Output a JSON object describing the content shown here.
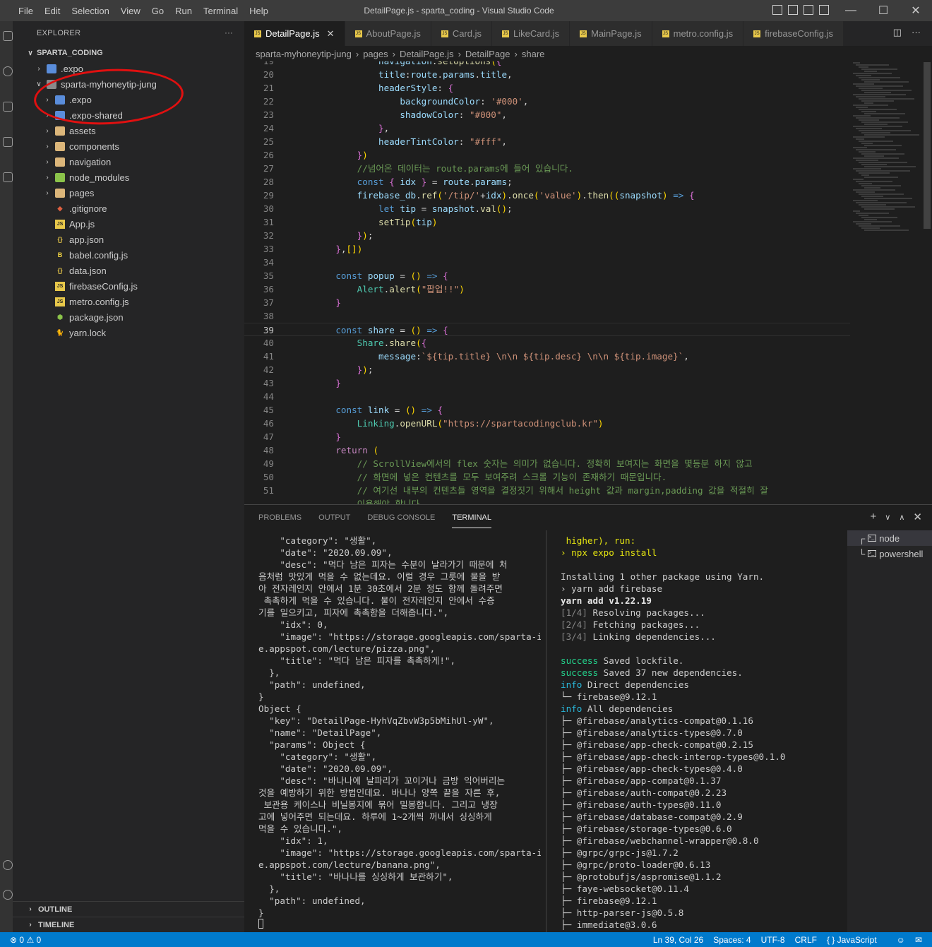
{
  "window": {
    "title": "DetailPage.js - sparta_coding - Visual Studio Code",
    "menu": [
      "File",
      "Edit",
      "Selection",
      "View",
      "Go",
      "Run",
      "Terminal",
      "Help"
    ]
  },
  "explorer": {
    "header": "EXPLORER",
    "more": "···",
    "root": "SPARTA_CODING",
    "items": [
      {
        "label": ".expo",
        "icon": "folder-expo-icon"
      },
      {
        "label": "sparta-myhoneytip-jung",
        "icon": "folder-open-icon"
      },
      {
        "label": ".expo",
        "icon": "folder-expo-icon"
      },
      {
        "label": ".expo-shared",
        "icon": "folder-expo-icon"
      },
      {
        "label": "assets",
        "icon": "folder-icon"
      },
      {
        "label": "components",
        "icon": "folder-icon"
      },
      {
        "label": "navigation",
        "icon": "folder-icon"
      },
      {
        "label": "node_modules",
        "icon": "folder-node-icon"
      },
      {
        "label": "pages",
        "icon": "folder-icon"
      },
      {
        "label": ".gitignore",
        "icon": "git-icon"
      },
      {
        "label": "App.js",
        "icon": "js-file-icon"
      },
      {
        "label": "app.json",
        "icon": "json-file-icon"
      },
      {
        "label": "babel.config.js",
        "icon": "babel-icon"
      },
      {
        "label": "data.json",
        "icon": "json-file-icon"
      },
      {
        "label": "firebaseConfig.js",
        "icon": "js-file-icon"
      },
      {
        "label": "metro.config.js",
        "icon": "js-file-icon"
      },
      {
        "label": "package.json",
        "icon": "nodejs-icon"
      },
      {
        "label": "yarn.lock",
        "icon": "yarn-icon"
      }
    ],
    "outline": "OUTLINE",
    "timeline": "TIMELINE"
  },
  "tabs": [
    {
      "label": "DetailPage.js",
      "active": true
    },
    {
      "label": "AboutPage.js"
    },
    {
      "label": "Card.js"
    },
    {
      "label": "LikeCard.js"
    },
    {
      "label": "MainPage.js"
    },
    {
      "label": "metro.config.js"
    },
    {
      "label": "firebaseConfig.js"
    }
  ],
  "breadcrumb": [
    "sparta-myhoneytip-jung",
    "pages",
    "DetailPage.js",
    "DetailPage",
    "share"
  ],
  "code": {
    "first_line": 19,
    "current_line": 39,
    "lines": [
      "            navigation.setOptions({",
      "            title:route.params.title,",
      "            headerStyle: {",
      "                backgroundColor: '#000',",
      "                shadowColor: \"#000\",",
      "            },",
      "            headerTintColor: \"#fff\",",
      "        })",
      "        //넘어온 데이터는 route.params에 들어 있습니다.",
      "        const { idx } = route.params;",
      "        firebase_db.ref('/tip/'+idx).once('value').then((snapshot) => {",
      "            let tip = snapshot.val();",
      "            setTip(tip)",
      "        });",
      "    },[])",
      "",
      "    const popup = () => {",
      "        Alert.alert(\"팝업!!\")",
      "    }",
      "",
      "    const share = () => {",
      "        Share.share({",
      "            message:`${tip.title} \\n\\n ${tip.desc} \\n\\n ${tip.image}`,",
      "        });",
      "    }",
      "",
      "    const link = () => {",
      "        Linking.openURL(\"https://spartacodingclub.kr\")",
      "    }",
      "    return (",
      "        // ScrollView에서의 flex 숫자는 의미가 없습니다. 정확히 보여지는 화면을 몇등분 하지 않고",
      "        // 화면에 넣은 컨텐츠를 모두 보여주려 스크롤 기능이 존재하기 때문입니다.",
      "        // 여기선 내부의 컨텐츠들 영역을 결정짓기 위해서 height 값과 margin,padding 값을 적절히 잘",
      "        이용해야 합니다."
    ]
  },
  "panel": {
    "tabs": [
      "PROBLEMS",
      "OUTPUT",
      "DEBUG CONSOLE",
      "TERMINAL"
    ],
    "active_tab": "TERMINAL",
    "terminal_left": [
      "    \"category\": \"생활\",",
      "    \"date\": \"2020.09.09\",",
      "    \"desc\": \"먹다 남은 피자는 수분이 날라가기 때문에 처",
      "음처럼 맛있게 먹을 수 없는데요. 이럴 경우 그릇에 물을 받",
      "아 전자레인지 안에서 1분 30초에서 2분 정도 함께 돌려주면",
      " 촉촉하게 먹을 수 있습니다. 물이 전자레인지 안에서 수증",
      "기를 일으키고, 피자에 촉촉함을 더해줍니다.\",",
      "    \"idx\": 0,",
      "    \"image\": \"https://storage.googleapis.com/sparta-imag",
      "e.appspot.com/lecture/pizza.png\",",
      "    \"title\": \"먹다 남은 피자를 촉촉하게!\",",
      "  },",
      "  \"path\": undefined,",
      "}",
      "Object {",
      "  \"key\": \"DetailPage-HyhVqZbvW3p5bMihUl-yW\",",
      "  \"name\": \"DetailPage\",",
      "  \"params\": Object {",
      "    \"category\": \"생활\",",
      "    \"date\": \"2020.09.09\",",
      "    \"desc\": \"바나나에 날파리가 꼬이거나 금방 익어버리는",
      "것을 예방하기 위한 방법인데요. 바나나 양쪽 끝을 자른 후,",
      " 보관용 케이스나 비닐봉지에 묶어 밀봉합니다. 그리고 냉장",
      "고에 넣어주면 되는데요. 하루에 1~2개씩 꺼내서 싱싱하게",
      "먹을 수 있습니다.\",",
      "    \"idx\": 1,",
      "    \"image\": \"https://storage.googleapis.com/sparta-imag",
      "e.appspot.com/lecture/banana.png\",",
      "    \"title\": \"바나나를 싱싱하게 보관하기\",",
      "  },",
      "  \"path\": undefined,",
      "}"
    ],
    "terminal_right": [
      " higher), run:",
      "› npx expo install",
      "",
      "Installing 1 other package using Yarn.",
      "› yarn add firebase",
      "yarn add v1.22.19",
      "[1/4] Resolving packages...",
      "[2/4] Fetching packages...",
      "[3/4] Linking dependencies...",
      "",
      "success Saved lockfile.",
      "success Saved 37 new dependencies.",
      "info Direct dependencies",
      "└─ firebase@9.12.1",
      "info All dependencies",
      "├─ @firebase/analytics-compat@0.1.16",
      "├─ @firebase/analytics-types@0.7.0",
      "├─ @firebase/app-check-compat@0.2.15",
      "├─ @firebase/app-check-interop-types@0.1.0",
      "├─ @firebase/app-check-types@0.4.0",
      "├─ @firebase/app-compat@0.1.37",
      "├─ @firebase/auth-compat@0.2.23",
      "├─ @firebase/auth-types@0.11.0",
      "├─ @firebase/database-compat@0.2.9",
      "├─ @firebase/storage-types@0.6.0",
      "├─ @firebase/webchannel-wrapper@0.8.0",
      "├─ @grpc/grpc-js@1.7.2",
      "├─ @grpc/proto-loader@0.6.13",
      "├─ @protobufjs/aspromise@1.1.2",
      "├─ faye-websocket@0.11.4",
      "├─ firebase@9.12.1",
      "├─ http-parser-js@0.5.8",
      "├─ immediate@3.0.6"
    ],
    "terminals": [
      "node",
      "powershell"
    ]
  },
  "statusbar": {
    "errors": "0",
    "warnings": "0",
    "position": "Ln 39, Col 26",
    "spaces": "Spaces: 4",
    "encoding": "UTF-8",
    "eol": "CRLF",
    "language": "JavaScript"
  },
  "colors": {
    "statusbar": "#007acc",
    "annotation_circle": "#e01010"
  }
}
